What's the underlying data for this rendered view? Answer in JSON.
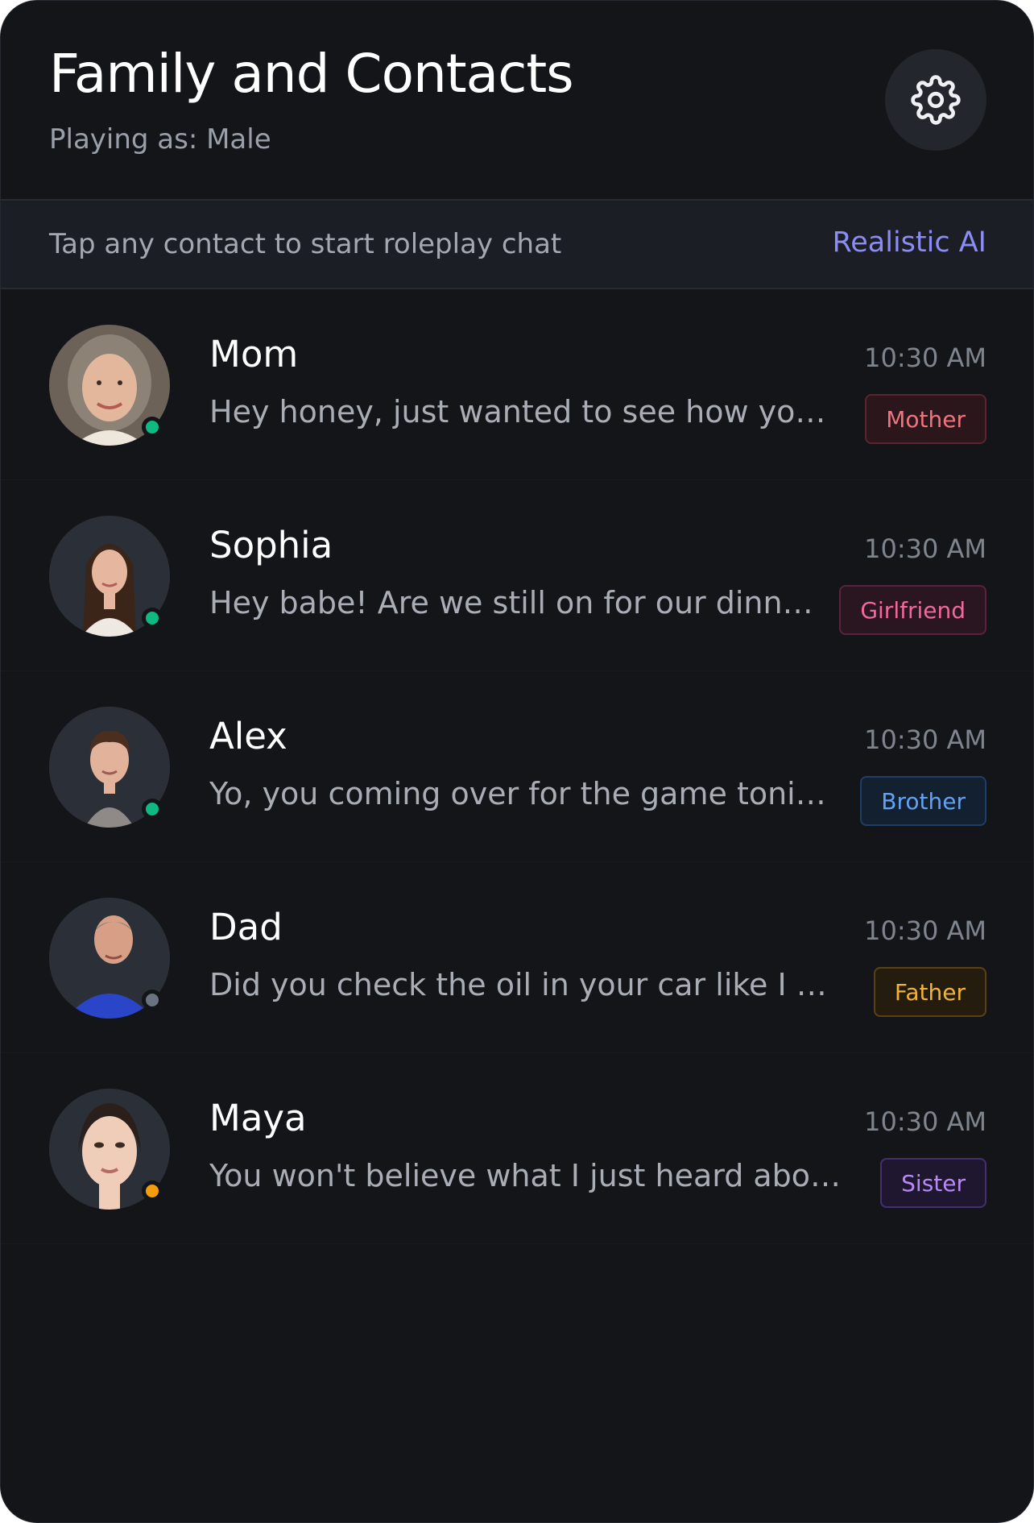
{
  "header": {
    "title": "Family and Contacts",
    "subtitle": "Playing as: Male",
    "settings_icon": "gear-icon"
  },
  "banner": {
    "text": "Tap any contact to start roleplay chat",
    "tag": "Realistic AI"
  },
  "contacts": [
    {
      "name": "Mom",
      "time": "10:30 AM",
      "preview": "Hey honey, just wanted to see how your day went…",
      "relation": "Mother",
      "status_color": "#10b981"
    },
    {
      "name": "Sophia",
      "time": "10:30 AM",
      "preview": "Hey babe! Are we still on for our dinner date…",
      "relation": "Girlfriend",
      "status_color": "#10b981"
    },
    {
      "name": "Alex",
      "time": "10:30 AM",
      "preview": "Yo, you coming over for the game tonight?",
      "relation": "Brother",
      "status_color": "#10b981"
    },
    {
      "name": "Dad",
      "time": "10:30 AM",
      "preview": "Did you check the oil in your car like I asked…",
      "relation": "Father",
      "status_color": "#6b7280"
    },
    {
      "name": "Maya",
      "time": "10:30 AM",
      "preview": "You won't believe what I just heard about…",
      "relation": "Sister",
      "status_color": "#f59e0b"
    }
  ],
  "colors": {
    "background": "#141519",
    "accent": "#8b8cf6",
    "online": "#10b981",
    "away": "#f59e0b",
    "offline": "#6b7280"
  }
}
